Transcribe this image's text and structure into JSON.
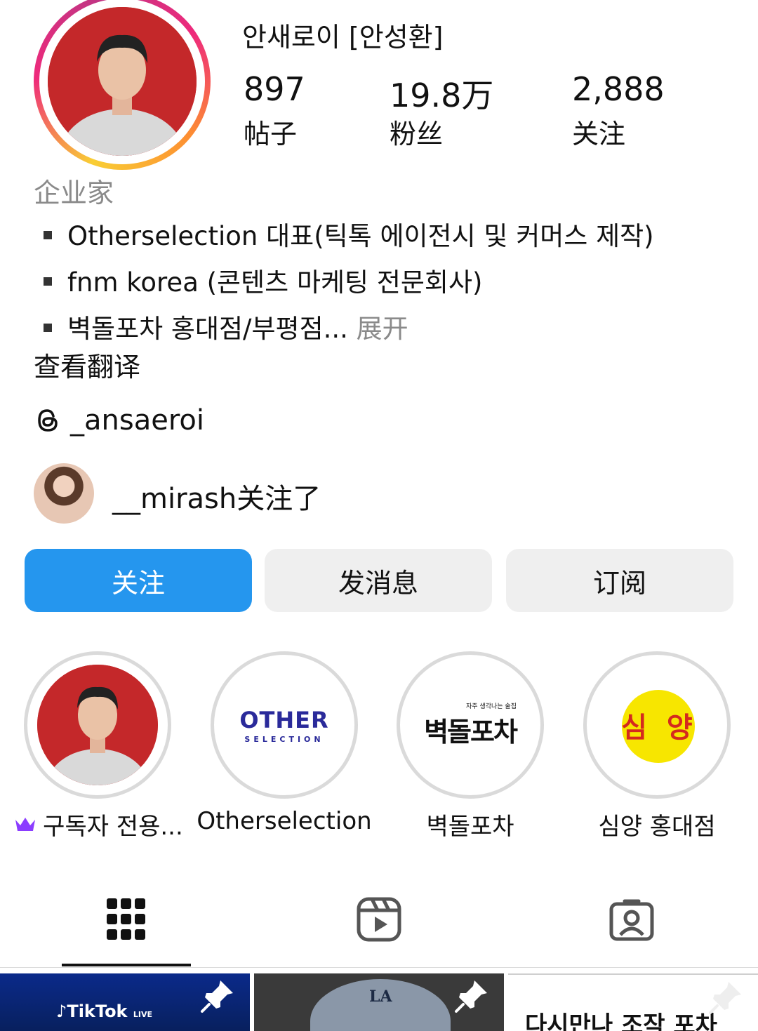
{
  "profile": {
    "name": "안새로이 [안성환]",
    "stats": [
      {
        "value": "897",
        "label": "帖子"
      },
      {
        "value": "19.8万",
        "label": "粉丝"
      },
      {
        "value": "2,888",
        "label": "关注"
      }
    ],
    "category": "企业家",
    "bio": [
      "Otherselection 대표(틱톡 에이전시 및 커머스 제작)",
      "fnm korea (콘텐츠 마케팅 전문회사)",
      "벽돌포차 홍대점/부평점..."
    ],
    "bio_more": " 展开",
    "translate_label": "查看翻译",
    "threads_handle": "_ansaeroi",
    "mutual_text": "__mirash关注了"
  },
  "actions": {
    "follow": "关注",
    "message": "发消息",
    "subscribe": "订阅"
  },
  "highlights": [
    {
      "label": "구독자 전용...",
      "logo": ""
    },
    {
      "label": "Otherselection",
      "logo": "OTHER",
      "logo_sub": "SELECTION"
    },
    {
      "label": "벽돌포차",
      "logo": "벽돌포차",
      "logo_sub": "자주 생각나는 술집"
    },
    {
      "label": "심양 홍대점",
      "logo": "심  양"
    }
  ],
  "tabs": [
    "grid-icon",
    "reels-icon",
    "tagged-icon"
  ],
  "posts": [
    {
      "text": "TikTok",
      "badge": "LIVE"
    },
    {
      "text": "LA"
    },
    {
      "text": "다시만나 조작 포차"
    }
  ],
  "colors": {
    "accent": "#2596ee",
    "secondary_button": "#efefef",
    "muted_text": "#8a8a8a",
    "avatar_bg": "#c4282a",
    "crown": "#8b3dff"
  }
}
